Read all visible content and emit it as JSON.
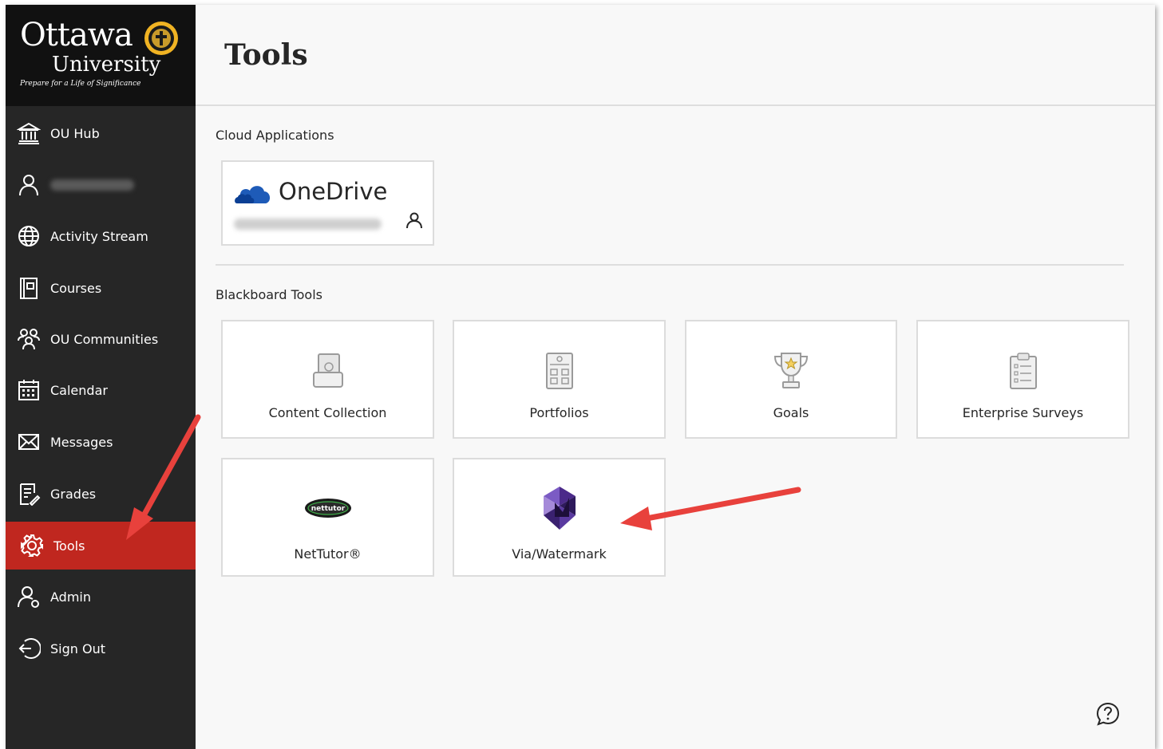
{
  "brand": {
    "name_line1": "Ottawa",
    "name_line2": "University",
    "tagline": "Prepare for a Life of Significance"
  },
  "sidebar": {
    "items": [
      {
        "label": "OU Hub",
        "icon": "institution-icon"
      },
      {
        "label": "",
        "icon": "user-icon"
      },
      {
        "label": "Activity Stream",
        "icon": "globe-icon"
      },
      {
        "label": "Courses",
        "icon": "book-icon"
      },
      {
        "label": "OU Communities",
        "icon": "people-icon"
      },
      {
        "label": "Calendar",
        "icon": "calendar-icon"
      },
      {
        "label": "Messages",
        "icon": "envelope-icon"
      },
      {
        "label": "Grades",
        "icon": "grades-icon"
      },
      {
        "label": "Tools",
        "icon": "gear-icon",
        "active": true
      },
      {
        "label": "Admin",
        "icon": "admin-icon"
      },
      {
        "label": "Sign Out",
        "icon": "sign-out-icon"
      }
    ]
  },
  "page": {
    "title": "Tools"
  },
  "cloud": {
    "section_label": "Cloud Applications",
    "onedrive_label": "OneDrive"
  },
  "blackboard": {
    "section_label": "Blackboard Tools",
    "tools": [
      {
        "label": "Content Collection",
        "icon": "content-collection-icon"
      },
      {
        "label": "Portfolios",
        "icon": "portfolio-icon"
      },
      {
        "label": "Goals",
        "icon": "trophy-icon"
      },
      {
        "label": "Enterprise Surveys",
        "icon": "clipboard-icon"
      },
      {
        "label": "NetTutor®",
        "icon": "nettutor-logo-icon",
        "logo_text": "nettutor"
      },
      {
        "label": "Via/Watermark",
        "icon": "watermark-logo-icon"
      }
    ]
  },
  "colors": {
    "sidebar_bg": "#262626",
    "active_bg": "#c0271f",
    "arrow": "#e8413c",
    "watermark_purple": "#4b2a8a"
  }
}
